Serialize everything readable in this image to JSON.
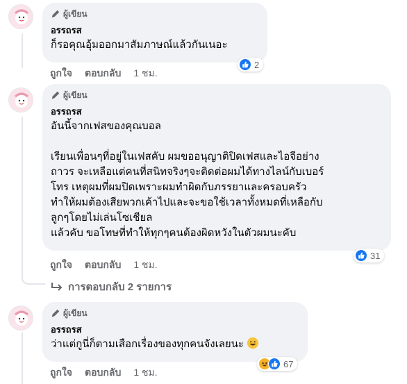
{
  "colors": {
    "like": "#1877f2",
    "haha": "#f7b125",
    "bubble": "#f0f2f5",
    "muted": "#65676b"
  },
  "comments": [
    {
      "badge": "ผู้เขียน",
      "author": "อรรถรส",
      "text": "ก็รอคุณอุ้มออกมาสัมภาษณ์แล้วกันเนอะ",
      "reaction_count": "2",
      "like_label": "ถูกใจ",
      "reply_label": "ตอบกลับ",
      "time": "1 ชม."
    },
    {
      "badge": "ผู้เขียน",
      "author": "อรรถรส",
      "text": "อันนี้จากเฟสของคุณบอล\n\nเรียนเพื่อนๆที่อยู่ในเฟสคับ ผมขออนุญาติปิดเฟสและไอจีอย่าง\nถาวร จะเหลือแต่คนที่สนิทจริงๆจะติดต่อผมได้ทางไลน์กับเบอร์\nโทร เหตุผมที่ผมปิดเพราะผมทำผิดกับภรรยาและครอบครัว\nทำให้ผมต้องเสียพวกเค้าไปและจะขอใช้เวลาทั้งหมดที่เหลือกับ\nลูกๆโดยไม่เล่นโซเชียล\nแล้วคับ ขอโทษที่ทำให้ทุกๆคนต้องผิดหวังในตัวผมนะคับ",
      "reaction_count": "31",
      "like_label": "ถูกใจ",
      "reply_label": "ตอบกลับ",
      "time": "1 ชม."
    },
    {
      "badge": "ผู้เขียน",
      "author": "อรรถรส",
      "text": "ว่าแต่กูนี่ก็ตามเสือกเรื่องของทุกคนจังเลยนะ",
      "reaction_count": "67",
      "like_label": "ถูกใจ",
      "reply_label": "ตอบกลับ",
      "time": "1 ชม."
    }
  ],
  "replies_link": "การตอบกลับ 2 รายการ"
}
